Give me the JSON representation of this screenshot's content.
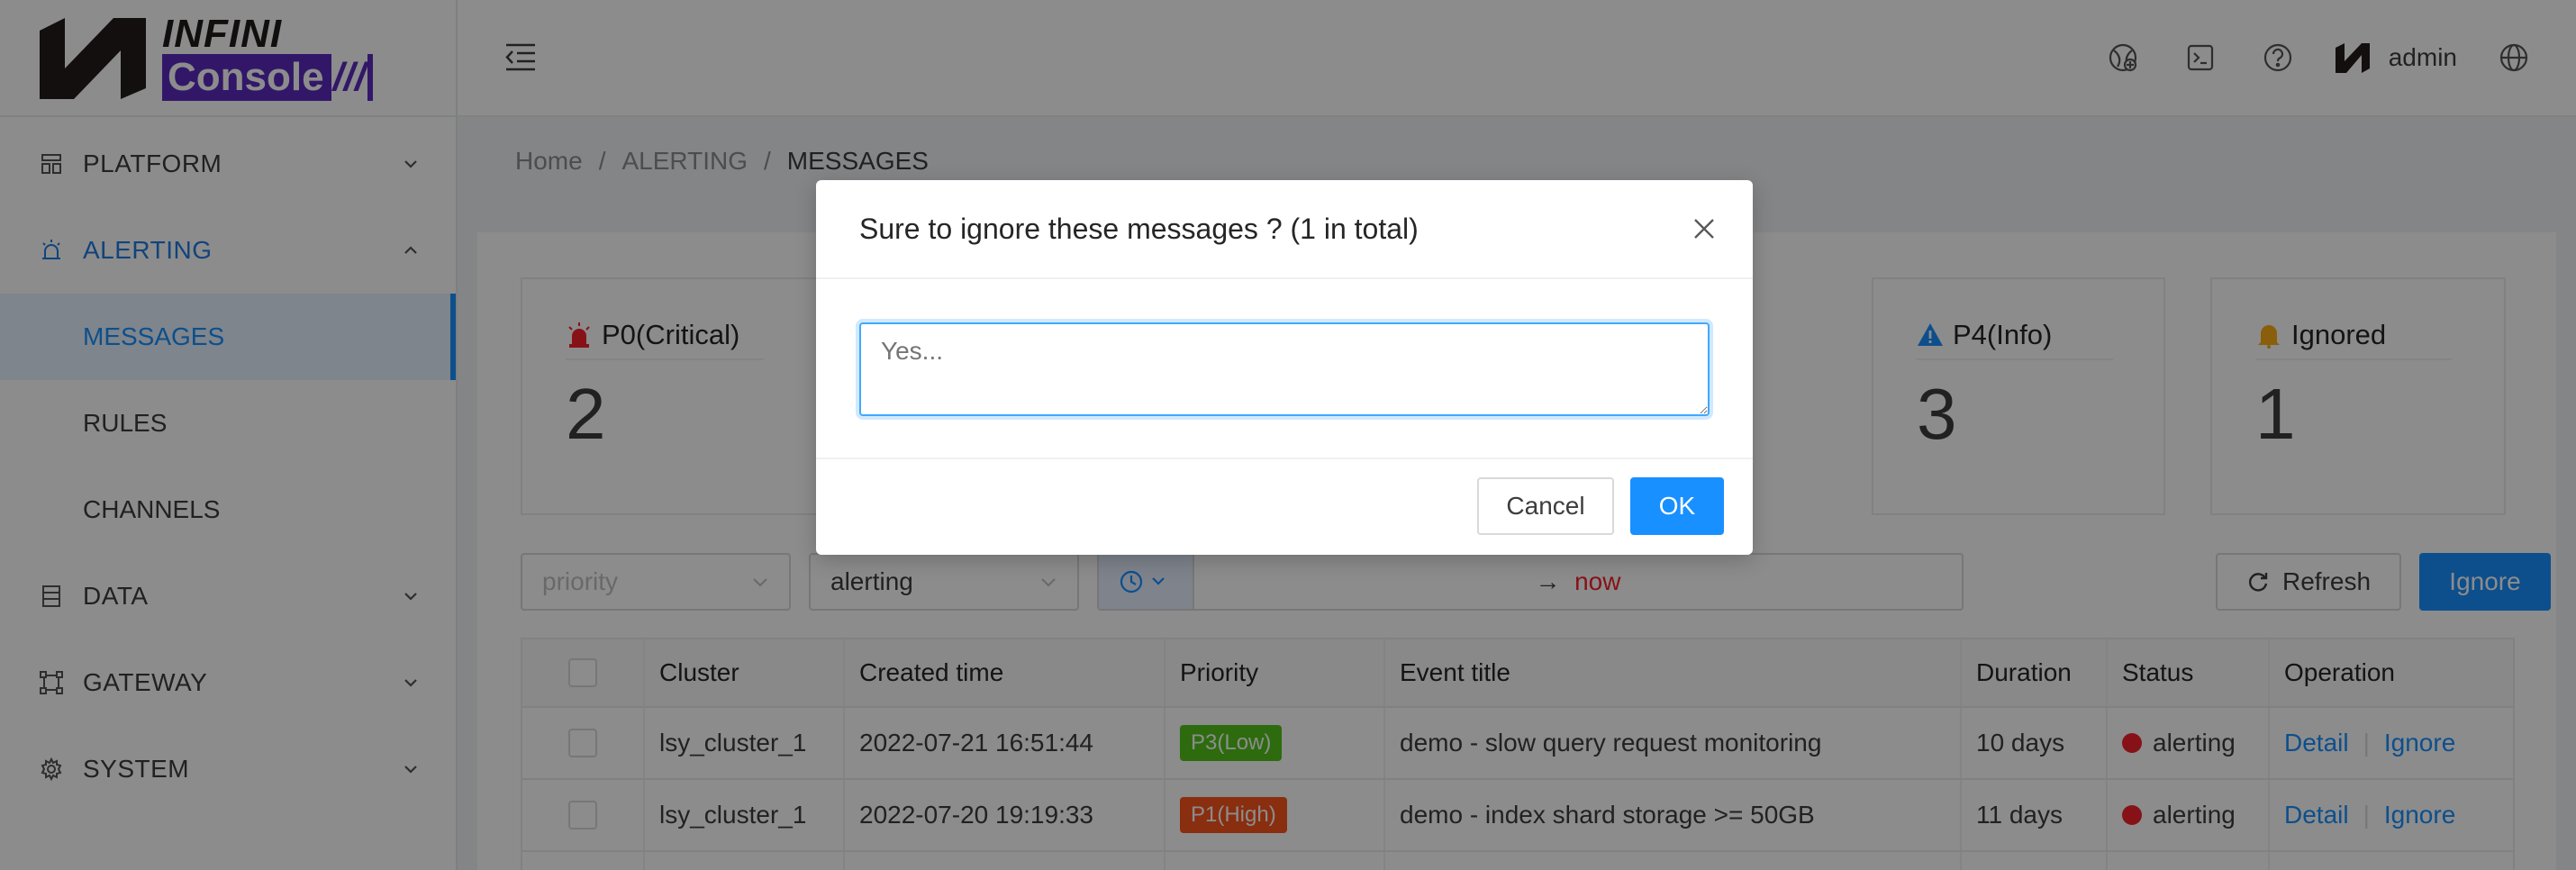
{
  "app": {
    "logo_top": "INFINI",
    "logo_bottom": "Console",
    "logo_slashes": "///"
  },
  "sidebar": {
    "items": [
      {
        "label": "PLATFORM",
        "icon": "platform-icon"
      },
      {
        "label": "ALERTING",
        "icon": "alarm-icon"
      },
      {
        "label": "DATA",
        "icon": "database-icon"
      },
      {
        "label": "GATEWAY",
        "icon": "gateway-icon"
      },
      {
        "label": "SYSTEM",
        "icon": "gear-icon"
      }
    ],
    "alerting_sub": [
      {
        "label": "MESSAGES"
      },
      {
        "label": "RULES"
      },
      {
        "label": "CHANNELS"
      }
    ]
  },
  "header": {
    "user": "admin"
  },
  "breadcrumb": {
    "items": [
      "Home",
      "ALERTING",
      "MESSAGES"
    ],
    "sep": "/"
  },
  "cards": [
    {
      "title": "P0(Critical)",
      "count": "2",
      "icon": "siren-icon",
      "color": "#f5222d"
    },
    {
      "title": "P4(Info)",
      "count": "3",
      "icon": "warning-triangle-icon",
      "color": "#1890ff"
    },
    {
      "title": "Ignored",
      "count": "1",
      "icon": "bell-icon",
      "color": "#faad14"
    }
  ],
  "filters": {
    "priority_placeholder": "priority",
    "status_value": "alerting",
    "time_arrow": "→",
    "time_end": "now",
    "refresh_label": "Refresh",
    "ignore_label": "Ignore"
  },
  "table": {
    "columns": [
      "Cluster",
      "Created time",
      "Priority",
      "Event title",
      "Duration",
      "Status",
      "Operation"
    ],
    "rows": [
      {
        "cluster": "lsy_cluster_1",
        "time": "2022-07-21 16:51:44",
        "priority": "P3(Low)",
        "priority_color": "#52c41a",
        "title": "demo - slow query request monitoring",
        "duration": "10 days",
        "status": "alerting",
        "op_detail": "Detail",
        "op_ignore": "Ignore"
      },
      {
        "cluster": "lsy_cluster_1",
        "time": "2022-07-20 19:19:33",
        "priority": "P1(High)",
        "priority_color": "#fa541c",
        "title": "demo - index shard storage >= 50GB",
        "duration": "11 days",
        "status": "alerting",
        "op_detail": "Detail",
        "op_ignore": "Ignore"
      }
    ]
  },
  "modal": {
    "title": "Sure to ignore these messages ? (1 in total)",
    "placeholder": "Yes...",
    "cancel_label": "Cancel",
    "ok_label": "OK"
  }
}
